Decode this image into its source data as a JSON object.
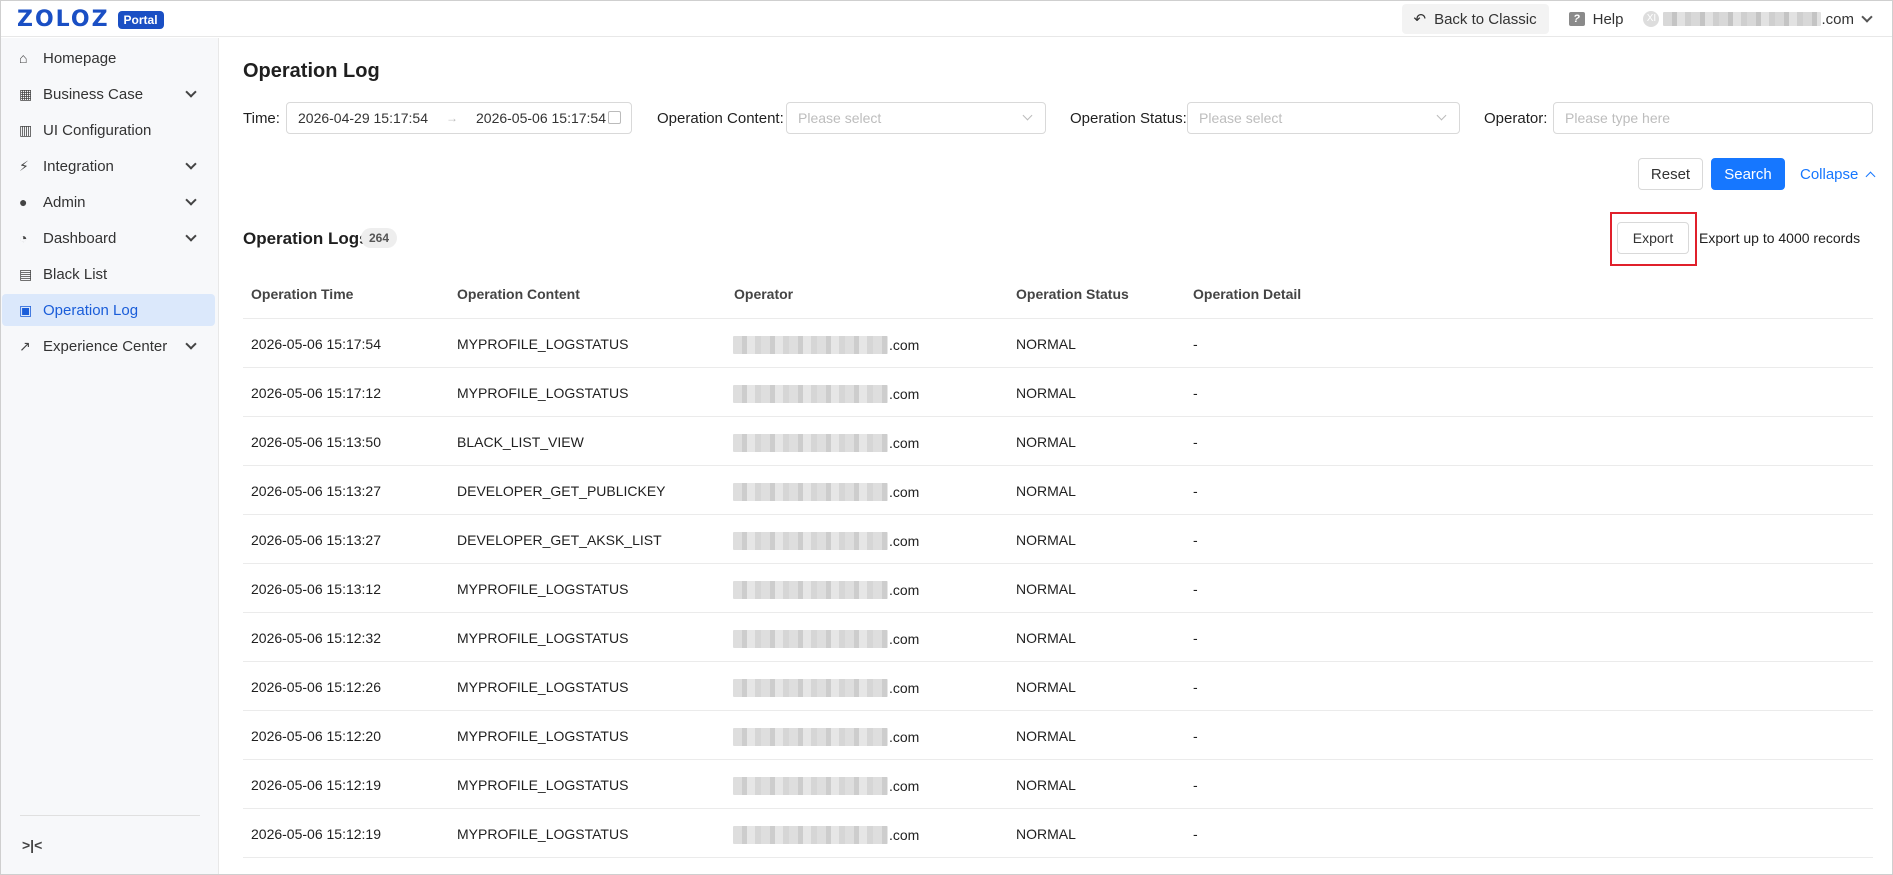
{
  "header": {
    "logo_text": "ZOLOZ",
    "logo_badge": "Portal",
    "back_label": "Back to Classic",
    "help_label": "Help",
    "user_suffix": ".com",
    "avatar_letter": "XI"
  },
  "sidebar": {
    "items": [
      {
        "label": "Homepage",
        "icon": "home-icon",
        "expandable": false,
        "active": false
      },
      {
        "label": "Business Case",
        "icon": "grid-icon",
        "expandable": true,
        "active": false
      },
      {
        "label": "UI Configuration",
        "icon": "layout-icon",
        "expandable": false,
        "active": false
      },
      {
        "label": "Integration",
        "icon": "plug-icon",
        "expandable": true,
        "active": false
      },
      {
        "label": "Admin",
        "icon": "user-icon",
        "expandable": true,
        "active": false
      },
      {
        "label": "Dashboard",
        "icon": "gauge-icon",
        "expandable": true,
        "active": false
      },
      {
        "label": "Black List",
        "icon": "blacklist-icon",
        "expandable": false,
        "active": false
      },
      {
        "label": "Operation Log",
        "icon": "log-icon",
        "expandable": false,
        "active": true
      },
      {
        "label": "Experience Center",
        "icon": "chart-icon",
        "expandable": true,
        "active": false
      }
    ],
    "collapse_label": ">|<"
  },
  "page": {
    "title": "Operation Log"
  },
  "filters": {
    "time_label": "Time",
    "date_start": "2026-04-29 15:17:54",
    "date_end": "2026-05-06 15:17:54",
    "date_separator": "→",
    "content_label": "Operation Content",
    "content_placeholder": "Please select",
    "status_label": "Operation Status",
    "status_placeholder": "Please select",
    "operator_label": "Operator",
    "operator_placeholder": "Please type here",
    "reset_label": "Reset",
    "search_label": "Search",
    "collapse_label": "Collapse"
  },
  "logs": {
    "title": "Operation Logs",
    "count": "264",
    "export_label": "Export",
    "export_note": "Export up to 4000 records",
    "columns": [
      "Operation Time",
      "Operation Content",
      "Operator",
      "Operation Status",
      "Operation Detail"
    ],
    "rows": [
      {
        "time": "2026-05-06 15:17:54",
        "content": "MYPROFILE_LOGSTATUS",
        "operator": ".com",
        "status": "NORMAL",
        "detail": "-"
      },
      {
        "time": "2026-05-06 15:17:12",
        "content": "MYPROFILE_LOGSTATUS",
        "operator": ".com",
        "status": "NORMAL",
        "detail": "-"
      },
      {
        "time": "2026-05-06 15:13:50",
        "content": "BLACK_LIST_VIEW",
        "operator": ".com",
        "status": "NORMAL",
        "detail": "-"
      },
      {
        "time": "2026-05-06 15:13:27",
        "content": "DEVELOPER_GET_PUBLICKEY",
        "operator": ".com",
        "status": "NORMAL",
        "detail": "-"
      },
      {
        "time": "2026-05-06 15:13:27",
        "content": "DEVELOPER_GET_AKSK_LIST",
        "operator": ".com",
        "status": "NORMAL",
        "detail": "-"
      },
      {
        "time": "2026-05-06 15:13:12",
        "content": "MYPROFILE_LOGSTATUS",
        "operator": ".com",
        "status": "NORMAL",
        "detail": "-"
      },
      {
        "time": "2026-05-06 15:12:32",
        "content": "MYPROFILE_LOGSTATUS",
        "operator": ".com",
        "status": "NORMAL",
        "detail": "-"
      },
      {
        "time": "2026-05-06 15:12:26",
        "content": "MYPROFILE_LOGSTATUS",
        "operator": ".com",
        "status": "NORMAL",
        "detail": "-"
      },
      {
        "time": "2026-05-06 15:12:20",
        "content": "MYPROFILE_LOGSTATUS",
        "operator": ".com",
        "status": "NORMAL",
        "detail": "-"
      },
      {
        "time": "2026-05-06 15:12:19",
        "content": "MYPROFILE_LOGSTATUS",
        "operator": ".com",
        "status": "NORMAL",
        "detail": "-"
      },
      {
        "time": "2026-05-06 15:12:19",
        "content": "MYPROFILE_LOGSTATUS",
        "operator": ".com",
        "status": "NORMAL",
        "detail": "-"
      }
    ]
  },
  "colors": {
    "brand": "#1a4fc4",
    "primary": "#1677ff",
    "active_bg": "#dbe8fb",
    "highlight": "#e0202b"
  }
}
